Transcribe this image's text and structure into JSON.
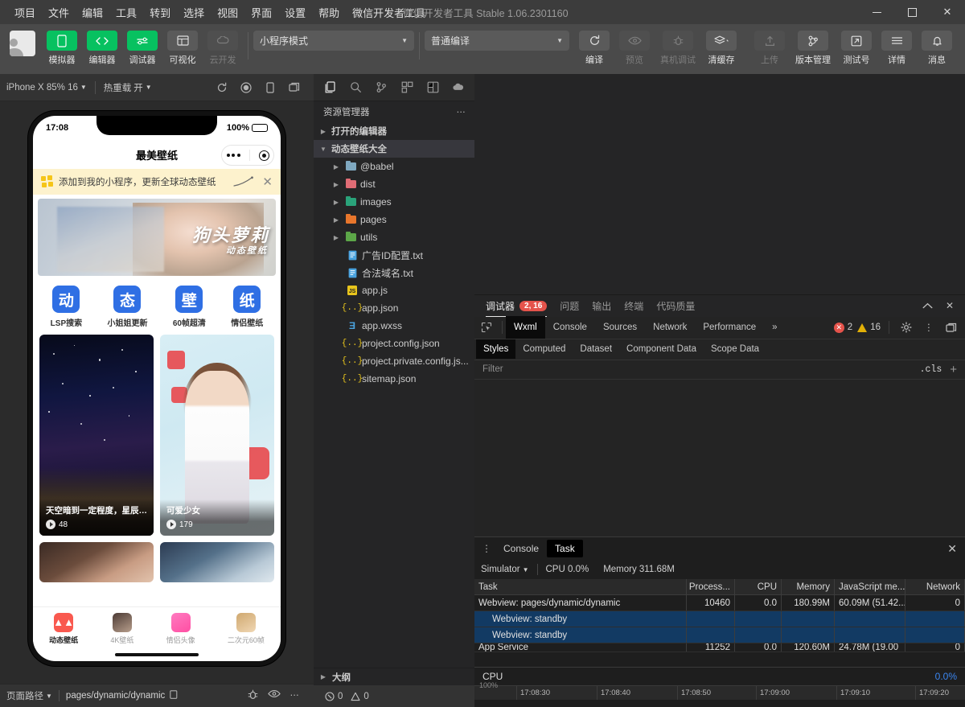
{
  "titlebar": {
    "menus": [
      "项目",
      "文件",
      "编辑",
      "工具",
      "转到",
      "选择",
      "视图",
      "界面",
      "设置",
      "帮助",
      "微信开发者工具"
    ],
    "window_title": "- 微信开发者工具 Stable 1.06.2301160",
    "minimize": "—",
    "maximize": "□",
    "close": "✕"
  },
  "toolbar": {
    "avatar_name": "user-avatar",
    "items": [
      {
        "label": "模拟器",
        "icon": "phone-icon",
        "state": "green"
      },
      {
        "label": "编辑器",
        "icon": "code-icon",
        "state": "green"
      },
      {
        "label": "调试器",
        "icon": "debug-sliders-icon",
        "state": "green"
      },
      {
        "label": "可视化",
        "icon": "layout-icon",
        "state": "normal"
      },
      {
        "label": "云开发",
        "icon": "cloud-icon",
        "state": "disabled"
      }
    ],
    "mode_select": "小程序模式",
    "compile_select": "普通编译",
    "actions": [
      {
        "label": "编译",
        "icon": "refresh-icon",
        "state": "normal"
      },
      {
        "label": "预览",
        "icon": "eye-icon",
        "state": "disabled"
      },
      {
        "label": "真机调试",
        "icon": "bug-icon",
        "state": "disabled"
      },
      {
        "label": "清缓存",
        "icon": "layers-icon",
        "state": "normal"
      }
    ],
    "right_actions": [
      {
        "label": "上传",
        "icon": "upload-icon",
        "state": "disabled"
      },
      {
        "label": "版本管理",
        "icon": "branch-icon",
        "state": "normal"
      },
      {
        "label": "测试号",
        "icon": "external-link-icon",
        "state": "normal"
      },
      {
        "label": "详情",
        "icon": "menu-icon",
        "state": "normal"
      },
      {
        "label": "消息",
        "icon": "bell-icon",
        "state": "normal"
      }
    ]
  },
  "simulator": {
    "device_select": "iPhone X 85% 16",
    "hotreload_label": "热重载",
    "hotreload_value": "开",
    "icons": [
      "refresh-icon",
      "record-icon",
      "rotate-device-icon",
      "multi-window-icon"
    ],
    "phone": {
      "time": "17:08",
      "battery_pct": "100%",
      "nav_title": "最美壁纸",
      "banner_text": "添加到我的小程序，更新全球动态壁纸",
      "banner_close": "✕",
      "hero_title": "狗头萝莉",
      "hero_subtitle": "动态壁纸",
      "quicknav": [
        {
          "glyph": "动",
          "label": "LSP搜索"
        },
        {
          "glyph": "态",
          "label": "小姐姐更新"
        },
        {
          "glyph": "壁",
          "label": "60帧超清"
        },
        {
          "glyph": "纸",
          "label": "情侣壁纸"
        }
      ],
      "cards": [
        {
          "title": "天空暗到一定程度，星辰就…",
          "plays": "48"
        },
        {
          "title": "可爱少女",
          "plays": "179"
        }
      ],
      "tabbar": [
        {
          "label": "动态壁纸",
          "active": true
        },
        {
          "label": "4K壁纸",
          "active": false
        },
        {
          "label": "情侣头像",
          "active": false
        },
        {
          "label": "二次元60帧",
          "active": false
        }
      ]
    },
    "footer": {
      "page_path_label": "页面路径",
      "page_path": "pages/dynamic/dynamic",
      "copy_icon": "copy-icon",
      "icons": [
        "bug-icon",
        "eye-icon",
        "more-icon"
      ]
    }
  },
  "explorer": {
    "iconbar": [
      "files-icon",
      "search-icon",
      "source-control-icon",
      "extensions-icon",
      "mini-program-icon",
      "cloud-dev-icon"
    ],
    "title": "资源管理器",
    "more": "⋯",
    "sections": [
      {
        "label": "打开的编辑器",
        "expanded": false
      },
      {
        "label": "动态壁纸大全",
        "expanded": true
      }
    ],
    "folders": [
      {
        "name": "@babel",
        "color": "#7fa8c0"
      },
      {
        "name": "dist",
        "color": "#e06c75"
      },
      {
        "name": "images",
        "color": "#2aa37a"
      },
      {
        "name": "pages",
        "color": "#e8762c"
      },
      {
        "name": "utils",
        "color": "#5ca648"
      }
    ],
    "files": [
      {
        "name": "广告ID配置.txt",
        "icon": "txt",
        "color": "#4aa3df"
      },
      {
        "name": "合法域名.txt",
        "icon": "txt",
        "color": "#4aa3df"
      },
      {
        "name": "app.js",
        "icon": "js",
        "color": "#e8c51c"
      },
      {
        "name": "app.json",
        "icon": "json",
        "color": "#e8c51c"
      },
      {
        "name": "app.wxss",
        "icon": "wxss",
        "color": "#4aa3df"
      },
      {
        "name": "project.config.json",
        "icon": "json",
        "color": "#e8c51c"
      },
      {
        "name": "project.private.config.js...",
        "icon": "json",
        "color": "#e8c51c"
      },
      {
        "name": "sitemap.json",
        "icon": "json",
        "color": "#e8c51c"
      }
    ],
    "outline_label": "大纲",
    "problems": {
      "errors": "0",
      "warnings": "0"
    }
  },
  "debugger": {
    "tabs": [
      {
        "label": "调试器",
        "badge": "2, 16",
        "active": true
      },
      {
        "label": "问题",
        "badge": null,
        "active": false
      },
      {
        "label": "输出",
        "badge": null,
        "active": false
      },
      {
        "label": "终端",
        "badge": null,
        "active": false
      },
      {
        "label": "代码质量",
        "badge": null,
        "active": false
      }
    ],
    "collapse_icon": "chevron-up-icon",
    "close_icon": "close-icon",
    "devtools_tabs": [
      {
        "label": "Wxml",
        "active": true
      },
      {
        "label": "Console",
        "active": false
      },
      {
        "label": "Sources",
        "active": false
      },
      {
        "label": "Network",
        "active": false
      },
      {
        "label": "Performance",
        "active": false
      }
    ],
    "overflow": "»",
    "error_count": "2",
    "warning_count": "16",
    "right_icons": [
      "gear-icon",
      "kebab-icon",
      "dock-icon"
    ],
    "styles_tabs": [
      {
        "label": "Styles",
        "active": true
      },
      {
        "label": "Computed",
        "active": false
      },
      {
        "label": "Dataset",
        "active": false
      },
      {
        "label": "Component Data",
        "active": false
      },
      {
        "label": "Scope Data",
        "active": false
      }
    ],
    "filter_placeholder": "Filter",
    "cls_label": ".cls",
    "plus_label": "+"
  },
  "task": {
    "tabs": [
      {
        "label": "Console",
        "active": false
      },
      {
        "label": "Task",
        "active": true
      }
    ],
    "close_icon": "close-icon",
    "source_select": "Simulator",
    "cpu_label": "CPU 0.0%",
    "memory_label": "Memory 311.68M",
    "columns": [
      "Task",
      "Process...",
      "CPU",
      "Memory",
      "JavaScript me...",
      "Network"
    ],
    "rows": [
      {
        "task": "Webview: pages/dynamic/dynamic",
        "process": "10460",
        "cpu": "0.0",
        "memory": "180.99M",
        "js": "60.09M (51.42...",
        "network": "0",
        "indent": 0,
        "selected": false
      },
      {
        "task": "Webview: standby",
        "process": "",
        "cpu": "",
        "memory": "",
        "js": "",
        "network": "",
        "indent": 1,
        "selected": true
      },
      {
        "task": "Webview: standby",
        "process": "",
        "cpu": "",
        "memory": "",
        "js": "",
        "network": "",
        "indent": 1,
        "selected": true
      },
      {
        "task": "App Service",
        "process": "11252",
        "cpu": "0.0",
        "memory": "120.60M",
        "js": "24.78M (19.00",
        "network": "0",
        "indent": 0,
        "selected": false
      }
    ]
  },
  "cpu_chart": {
    "title": "CPU",
    "value": "0.0%",
    "y_label": "100%",
    "ticks": [
      "17:08:30",
      "17:08:40",
      "17:08:50",
      "17:09:00",
      "17:09:10",
      "17:09:20"
    ]
  },
  "colors": {
    "accent_green": "#07c160",
    "error_red": "#e5534b",
    "warning_yellow": "#e2b007",
    "link_blue": "#3b86f0",
    "selection_blue": "#123a63"
  }
}
